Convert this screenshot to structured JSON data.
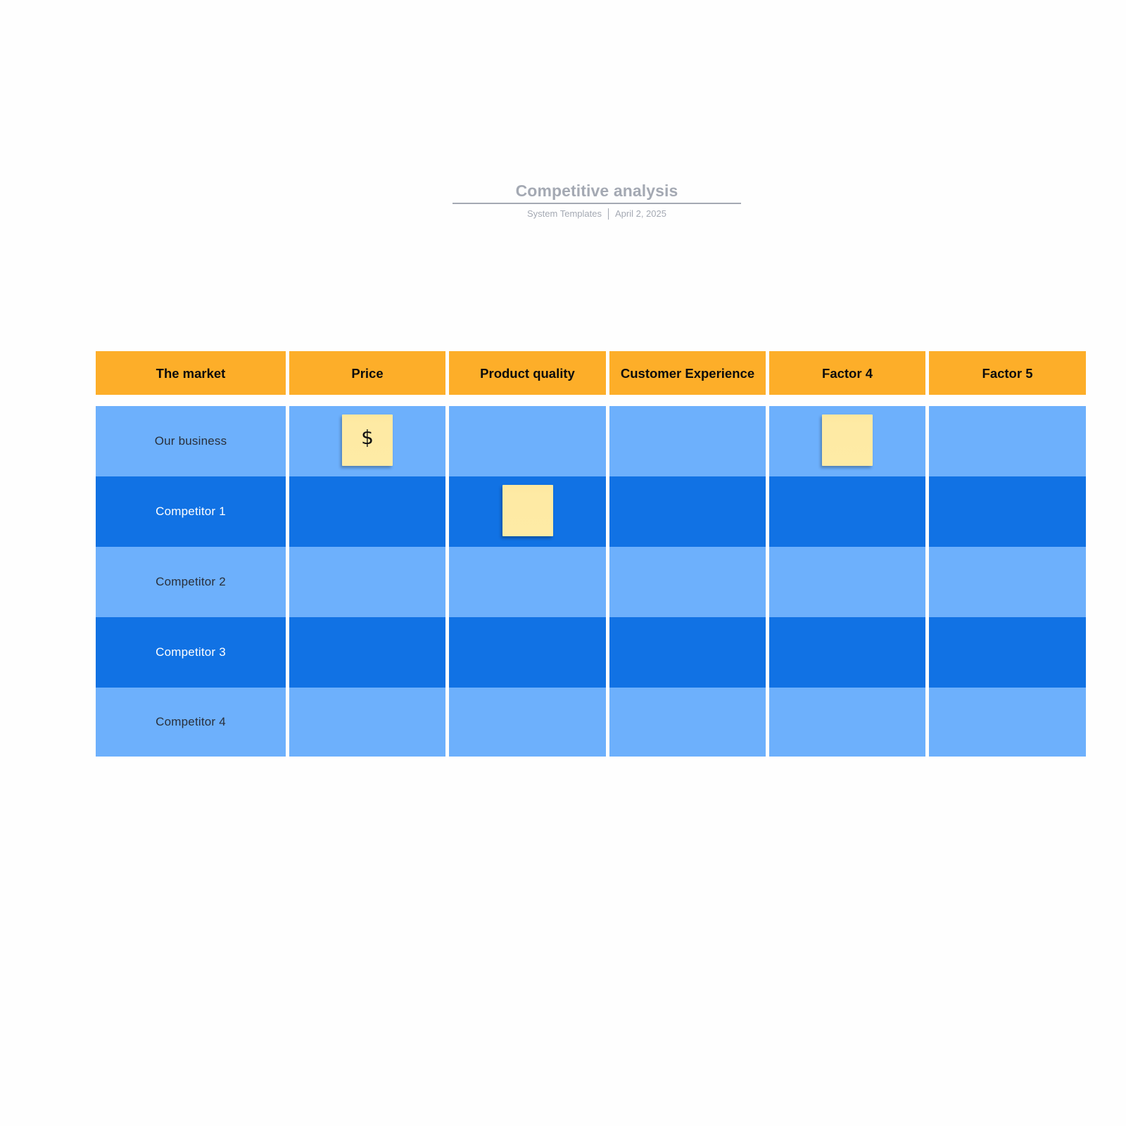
{
  "document": {
    "title": "Competitive analysis",
    "author": "System Templates",
    "date": "April 2, 2025"
  },
  "colors": {
    "header": "#fdae29",
    "row_light": "#6db0fc",
    "row_dark": "#1172e4",
    "sticky_note": "#feeaa4",
    "title_gray": "#a4a9b3"
  },
  "table": {
    "headers": [
      "The market",
      "Price",
      "Product quality",
      "Customer Experience",
      "Factor 4",
      "Factor 5"
    ],
    "rows": [
      {
        "label": "Our business",
        "shade": "light"
      },
      {
        "label": "Competitor 1",
        "shade": "dark"
      },
      {
        "label": "Competitor 2",
        "shade": "light"
      },
      {
        "label": "Competitor 3",
        "shade": "dark"
      },
      {
        "label": "Competitor 4",
        "shade": "light"
      }
    ],
    "sticky_notes": [
      {
        "row": "Our business",
        "column": "Price",
        "text": "$"
      },
      {
        "row": "Competitor 1",
        "column": "Product quality",
        "text": ""
      },
      {
        "row": "Our business",
        "column": "Factor 4",
        "text": ""
      }
    ]
  }
}
